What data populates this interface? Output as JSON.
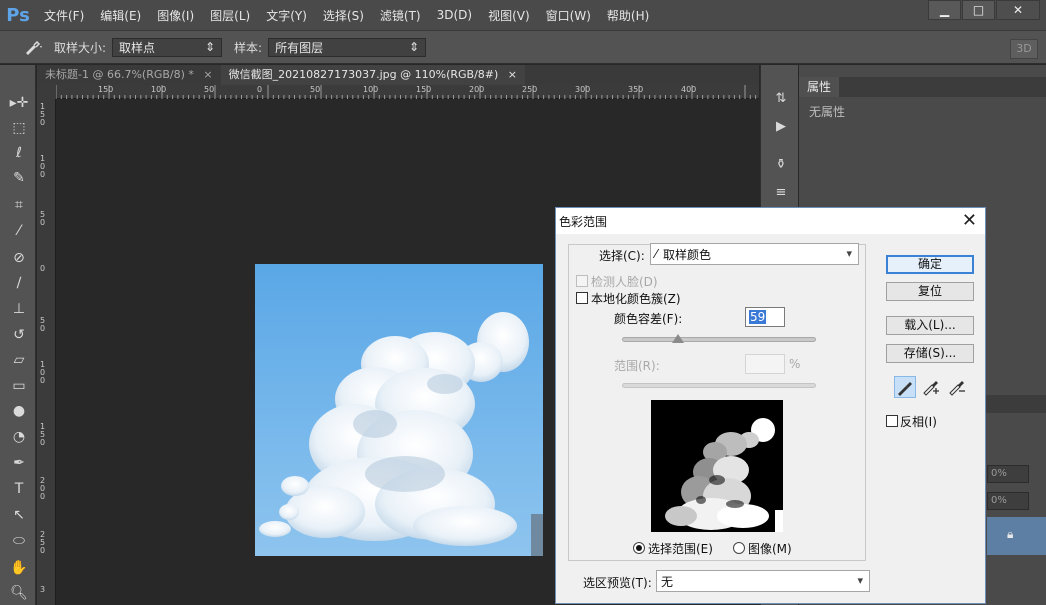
{
  "app": {
    "logo": "Ps",
    "menu": [
      "文件(F)",
      "编辑(E)",
      "图像(I)",
      "图层(L)",
      "文字(Y)",
      "选择(S)",
      "滤镜(T)",
      "3D(D)",
      "视图(V)",
      "窗口(W)",
      "帮助(H)"
    ],
    "window_controls": [
      "▁",
      "□",
      "✕"
    ]
  },
  "options_bar": {
    "sample_size_label": "取样大小:",
    "sample_size_value": "取样点",
    "sample_label": "样本:",
    "sample_value": "所有图层",
    "btn_3d": "3D"
  },
  "documents": {
    "tabs": [
      {
        "label": "未标题-1 @ 66.7%(RGB/8) *",
        "close": "×"
      },
      {
        "label": "微信截图_20210827173037.jpg @ 110%(RGB/8#)",
        "close": "×"
      }
    ],
    "ruler_h": [
      "150",
      "100",
      "50",
      "0",
      "50",
      "100",
      "150",
      "200",
      "250",
      "300",
      "350",
      "400"
    ],
    "ruler_v": [
      "1 5 0",
      "1 0 0",
      "5 0",
      "0",
      "5 0",
      "1 0 0",
      "1 5 0",
      "2 0 0",
      "2 5 0",
      "3"
    ]
  },
  "properties_panel": {
    "tab": "属性",
    "empty_text": "无属性",
    "field_a": "0%",
    "field_b": "0%"
  },
  "color_range_dialog": {
    "title": "色彩范围",
    "close": "✕",
    "select_label": "选择(C):",
    "select_value": "取样颜色",
    "detect_faces": "检测人脸(D)",
    "localized_clusters": "本地化颜色簇(Z)",
    "fuzziness_label": "颜色容差(F):",
    "fuzziness_value": "59",
    "fuzziness_fraction": 0.29,
    "range_label": "范围(R):",
    "range_value": "",
    "range_unit": "%",
    "radio_selection": "选择范围(E)",
    "radio_image": "图像(M)",
    "selection_preview_label": "选区预览(T):",
    "selection_preview_value": "无",
    "buttons": {
      "ok": "确定",
      "reset": "复位",
      "load": "载入(L)...",
      "save": "存储(S)..."
    },
    "invert_label": "反相(I)"
  }
}
